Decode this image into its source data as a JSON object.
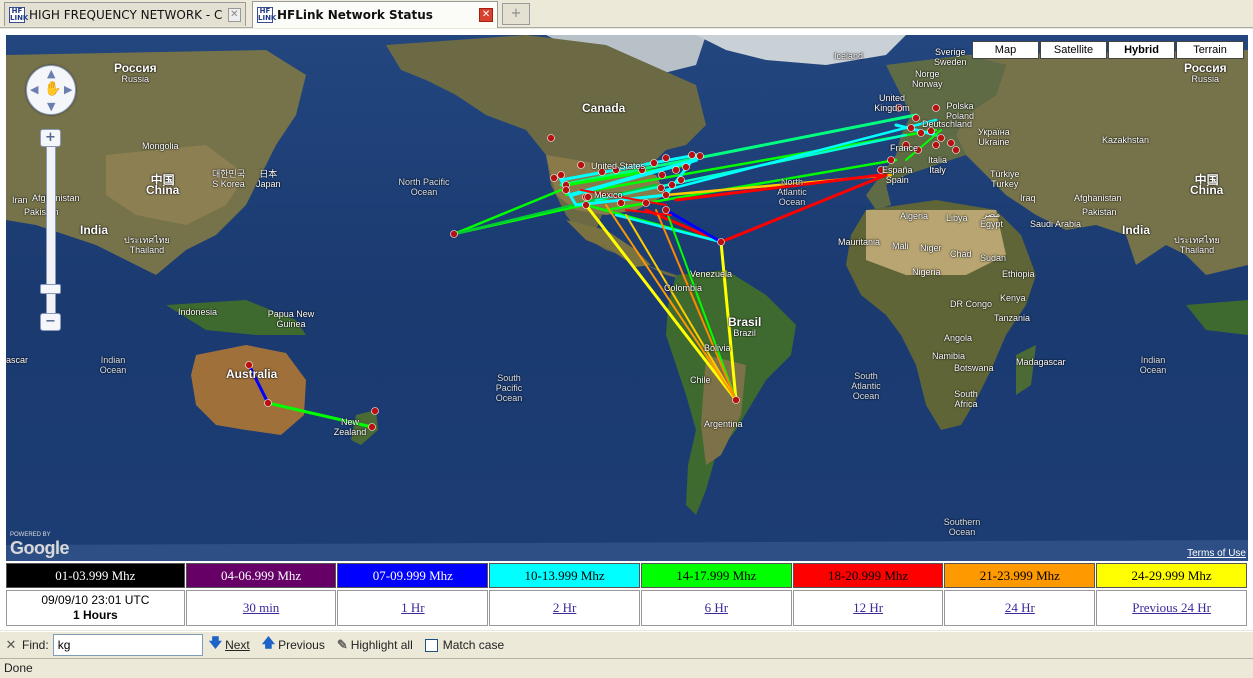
{
  "tabs": [
    {
      "title": "HIGH FREQUENCY NETWORK - C...",
      "active": false
    },
    {
      "title": "HFLink Network Status",
      "active": true
    }
  ],
  "map": {
    "types": [
      "Map",
      "Satellite",
      "Hybrid",
      "Terrain"
    ],
    "selected_type": "Hybrid",
    "powered_by": "POWERED BY",
    "google": "Google",
    "terms": "Terms of Use",
    "labels": {
      "russia_l": "Россия",
      "russia_l2": "Russia",
      "mongolia": "Mongolia",
      "china_l_zh": "中国",
      "china_l": "China",
      "skorea_zh": "대한민국",
      "skorea": "S Korea",
      "japan_zh": "日本",
      "japan": "Japan",
      "afghanistan_l": "Afghanistan",
      "pakistan_l": "Pakistan",
      "iran_l": "Iran",
      "india_l": "India",
      "thailand_l_zh": "ประเทศไทย",
      "thailand_l": "Thailand",
      "indonesia": "Indonesia",
      "papua": "Papua New Guinea",
      "indian_ocean_l": "Indian Ocean",
      "australia": "Australia",
      "new_zealand": "New Zealand",
      "north_pacific": "North Pacific Ocean",
      "canada": "Canada",
      "united_states": "United States",
      "mexico": "Mexico",
      "north_atlantic": "North Atlantic Ocean",
      "venezuela": "Venezuela",
      "colombia": "Colombia",
      "brasil": "Brasil",
      "brazil": "Brazil",
      "bolivia": "Bolivia",
      "chile": "Chile",
      "argentina": "Argentina",
      "south_pacific": "South Pacific Ocean",
      "south_atlantic": "South Atlantic Ocean",
      "iceland": "Iceland",
      "sverige": "Sverige",
      "sweden": "Sweden",
      "norge": "Norge",
      "norway": "Norway",
      "uk": "United Kingdom",
      "polska": "Polska",
      "poland": "Poland",
      "deutschland": "Deutschland",
      "ukraina": "Україна",
      "ukraine": "Ukraine",
      "france": "France",
      "espana": "España",
      "spain": "Spain",
      "italia": "Italia",
      "italy": "Italy",
      "turkiye": "Türkiye",
      "turkey": "Turkey",
      "kazakhstan": "Kazakhstan",
      "russia_r": "Россия",
      "russia_r2": "Russia",
      "china_r_zh": "中国",
      "china_r": "China",
      "algeria": "Algeria",
      "libya": "Libya",
      "misr": "مصر",
      "egypt": "Egypt",
      "iraq": "Iraq",
      "saudi": "Saudi Arabia",
      "afghanistan_r": "Afghanistan",
      "pakistan_r": "Pakistan",
      "india_r": "India",
      "thailand_r_zh": "ประเทศไทย",
      "thailand_r": "Thailand",
      "mauritania": "Mauritania",
      "mali": "Mali",
      "niger": "Niger",
      "chad": "Chad",
      "sudan": "Sudan",
      "nigeria": "Nigeria",
      "ethiopia": "Ethiopia",
      "drc": "DR Congo",
      "kenya": "Kenya",
      "tanzania": "Tanzania",
      "angola": "Angola",
      "namibia": "Namibia",
      "botswana": "Botswana",
      "south_africa": "South Africa",
      "madagascar": "Madagascar",
      "indian_ocean_r": "Indian Ocean",
      "southern_ocean": "Southern Ocean",
      "ascar": "ascar"
    }
  },
  "legend": {
    "bands": [
      {
        "label": "01-03.999 Mhz",
        "color": "#000000",
        "text": "#ffffff"
      },
      {
        "label": "04-06.999 Mhz",
        "color": "#660066",
        "text": "#ffffff"
      },
      {
        "label": "07-09.999 Mhz",
        "color": "#0000ff",
        "text": "#ffffff"
      },
      {
        "label": "10-13.999 Mhz",
        "color": "#00ffff",
        "text": "#000000"
      },
      {
        "label": "14-17.999 Mhz",
        "color": "#00ff00",
        "text": "#000000"
      },
      {
        "label": "18-20.999 Mhz",
        "color": "#ff0000",
        "text": "#000000"
      },
      {
        "label": "21-23.999 Mhz",
        "color": "#ff9900",
        "text": "#000000"
      },
      {
        "label": "24-29.999 Mhz",
        "color": "#ffff00",
        "text": "#000000"
      }
    ],
    "timestamp": "09/09/10 23:01 UTC",
    "duration": "1 Hours",
    "periods": [
      "30 min",
      "1 Hr",
      "2 Hr",
      "6 Hr",
      "12 Hr",
      "24 Hr",
      "Previous 24 Hr"
    ]
  },
  "findbar": {
    "close": "✕",
    "label": "Find:",
    "value": "kg",
    "next": "Next",
    "previous": "Previous",
    "highlight": "Highlight all",
    "match_case": "Match case"
  },
  "status": "Done"
}
